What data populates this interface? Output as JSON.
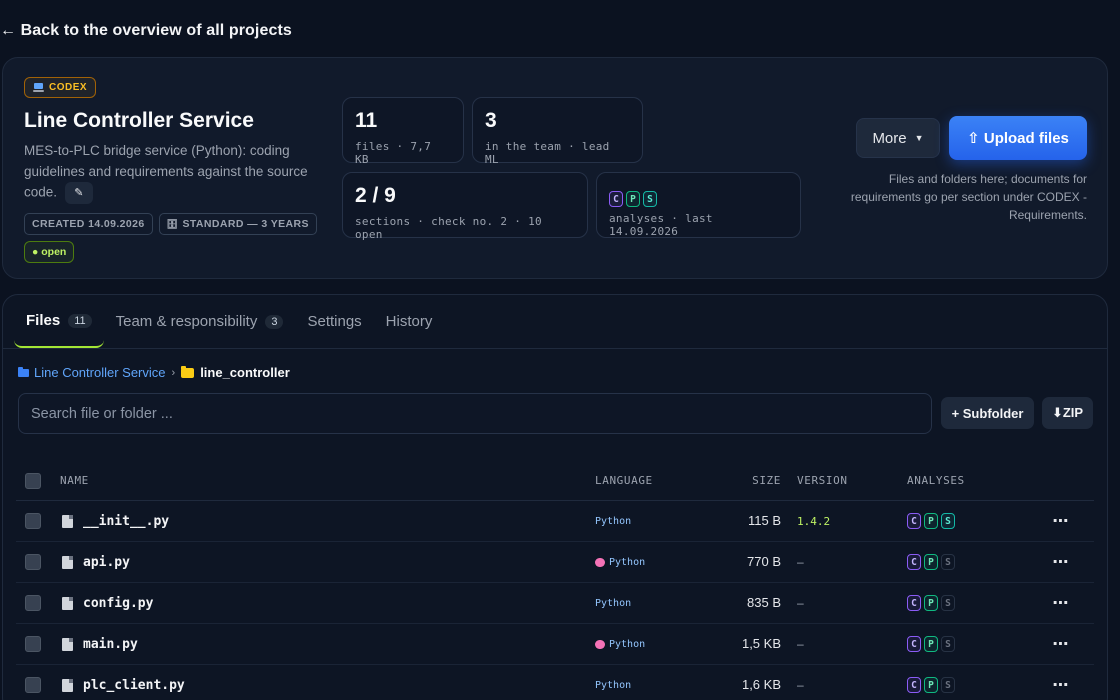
{
  "nav": {
    "back_label": "← Back to the overview of all projects"
  },
  "project": {
    "badge": "CODEX",
    "title": "Line Controller Service",
    "description": "MES-to-PLC bridge service (Python): coding guidelines and requirements against the source code.",
    "edit_icon": "✎",
    "created": "CREATED 14.09.2026",
    "retention": "STANDARD — 3 YEARS",
    "retention_icon": "🗄",
    "status": "● open"
  },
  "stats": {
    "files": {
      "value": "11",
      "label": "files · 7,7 KB"
    },
    "team": {
      "value": "3",
      "label": "in the team · lead ML"
    },
    "sections": {
      "value": "2 / 9",
      "label": "sections · check no. 2 · 10 open"
    },
    "analyses": {
      "badges": [
        "C",
        "P",
        "S"
      ],
      "label": "analyses · last 14.09.2026"
    }
  },
  "actions": {
    "more_label": "More",
    "more_caret": "▼",
    "upload_label": "⇧ Upload files",
    "upload_hint": "Files and folders here; documents for requirements go per section under CODEX - Requirements."
  },
  "tabs": [
    {
      "label": "Files",
      "count": "11"
    },
    {
      "label": "Team & responsibility",
      "count": "3"
    },
    {
      "label": "Settings",
      "count": ""
    },
    {
      "label": "History",
      "count": ""
    }
  ],
  "breadcrumb": {
    "root": "Line Controller Service",
    "separator": "›",
    "current": "line_controller"
  },
  "search": {
    "placeholder": "Search file or folder ..."
  },
  "toolbar": {
    "subfolder_label": "+ Subfolder",
    "zip_label": "⬇ZIP"
  },
  "table": {
    "headers": {
      "name": "NAME",
      "language": "LANGUAGE",
      "size": "SIZE",
      "version": "VERSION",
      "analyses": "ANALYSES"
    },
    "rows": [
      {
        "name": "__init__.py",
        "language": "Python",
        "ml": false,
        "size": "115 B",
        "version": "1.4.2",
        "analyses": [
          "C",
          "P",
          "S"
        ],
        "s_active": true,
        "actions": "⋯"
      },
      {
        "name": "api.py",
        "language": "Python",
        "ml": true,
        "size": "770 B",
        "version": "–",
        "analyses": [
          "C",
          "P",
          "S"
        ],
        "s_active": false,
        "actions": "⋯"
      },
      {
        "name": "config.py",
        "language": "Python",
        "ml": false,
        "size": "835 B",
        "version": "–",
        "analyses": [
          "C",
          "P",
          "S"
        ],
        "s_active": false,
        "actions": "⋯"
      },
      {
        "name": "main.py",
        "language": "Python",
        "ml": true,
        "size": "1,5 KB",
        "version": "–",
        "analyses": [
          "C",
          "P",
          "S"
        ],
        "s_active": false,
        "actions": "⋯"
      },
      {
        "name": "plc_client.py",
        "language": "Python",
        "ml": false,
        "size": "1,6 KB",
        "version": "–",
        "analyses": [
          "C",
          "P",
          "S"
        ],
        "s_active": false,
        "actions": "⋯"
      }
    ]
  },
  "colors": {
    "background": "#0b1220",
    "accent_blue": "#2563eb",
    "tab_underline": "#a3e635",
    "version_green": "#bef264",
    "codex_amber": "#fbbf24"
  }
}
